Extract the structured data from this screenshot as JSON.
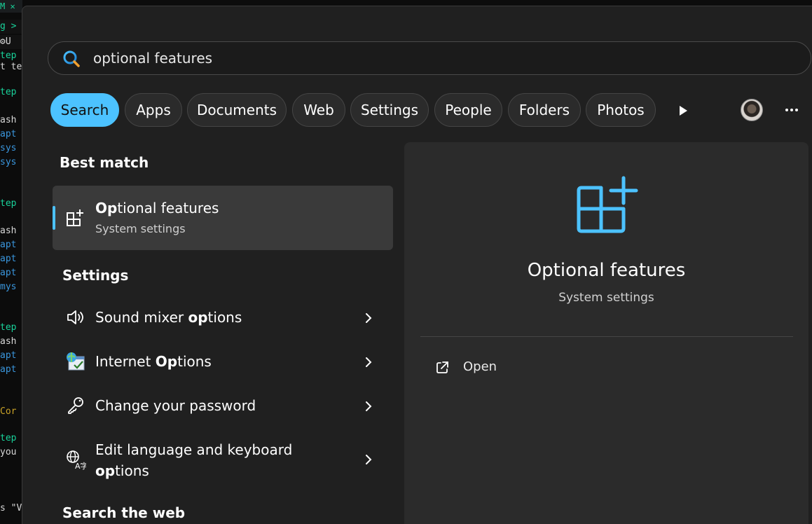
{
  "terminal": {
    "tab": "M ✕",
    "lines": [
      {
        "text": "g >",
        "cls": "green"
      },
      {
        "text": "⚙U",
        "cls": "white"
      },
      {
        "text": "tep",
        "cls": "green"
      },
      {
        "text": "t te",
        "cls": "white"
      },
      {
        "text": "tep",
        "cls": "green"
      },
      {
        "text": "ash",
        "cls": "white"
      },
      {
        "text": " apt",
        "cls": "blue"
      },
      {
        "text": " sys",
        "cls": "blue"
      },
      {
        "text": " sys",
        "cls": "blue"
      },
      {
        "text": "tep",
        "cls": "green"
      },
      {
        "text": "ash",
        "cls": "white"
      },
      {
        "text": " apt",
        "cls": "blue"
      },
      {
        "text": " apt",
        "cls": "blue"
      },
      {
        "text": " apt",
        "cls": "blue"
      },
      {
        "text": " mys",
        "cls": "blue"
      },
      {
        "text": "tep",
        "cls": "green"
      },
      {
        "text": "ash",
        "cls": "white"
      },
      {
        "text": " apt",
        "cls": "blue"
      },
      {
        "text": " apt",
        "cls": "blue"
      },
      {
        "text": "  Cor",
        "cls": "gold"
      },
      {
        "text": "tep",
        "cls": "green"
      },
      {
        "text": " you",
        "cls": "white"
      },
      {
        "text": "s \"V",
        "cls": "white"
      }
    ]
  },
  "search": {
    "value": "optional features",
    "icon": "search-icon"
  },
  "filters": [
    "Search",
    "Apps",
    "Documents",
    "Web",
    "Settings",
    "People",
    "Folders",
    "Photos"
  ],
  "best_match": {
    "heading": "Best match",
    "title_bold": "Op",
    "title_rest": "tional features",
    "subtitle": "System settings"
  },
  "settings": {
    "heading": "Settings",
    "items": [
      {
        "pre": "Sound mixer ",
        "bold": "op",
        "post": "tions",
        "icon": "speaker-icon"
      },
      {
        "pre": "Internet ",
        "bold": "Op",
        "post": "tions",
        "icon": "internet-options-icon"
      },
      {
        "pre": "Change your password",
        "bold": "",
        "post": "",
        "icon": "key-icon"
      },
      {
        "pre": "Edit language and keyboard",
        "bold": "op",
        "post": "tions",
        "icon": "language-icon"
      }
    ]
  },
  "web": {
    "heading": "Search the web"
  },
  "preview": {
    "title": "Optional features",
    "subtitle": "System settings",
    "open_label": "Open"
  },
  "colors": {
    "accent": "#4cc2ff",
    "panel": "#202020",
    "card": "#2b2b2b"
  }
}
